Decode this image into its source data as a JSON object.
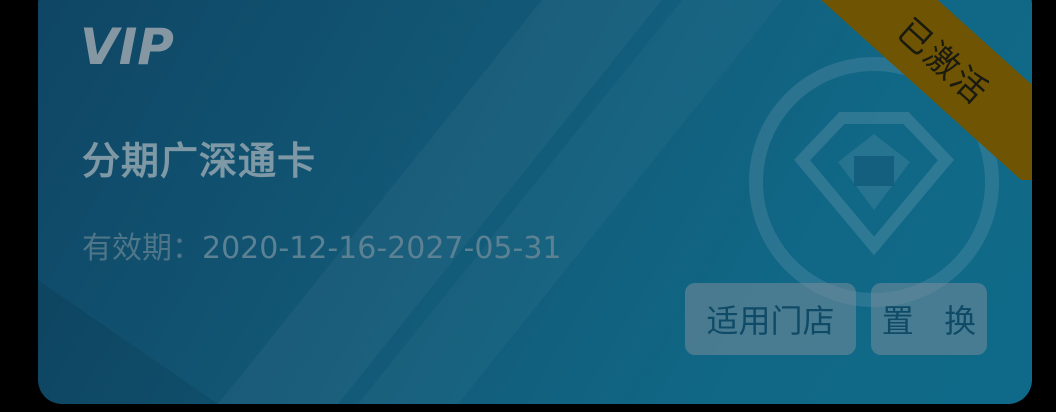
{
  "card": {
    "brand": "VIP",
    "title": "分期广深通卡",
    "validity_label": "有效期：",
    "validity_range": "2020-12-16-2027-05-31",
    "status_badge": "已激活"
  },
  "actions": {
    "stores_label": "适用门店",
    "replace_label": "置 换"
  },
  "colors": {
    "card_start": "#0f4564",
    "card_end": "#0e6a88",
    "badge": "#6e5403",
    "button_bg": "#7a8d9b"
  },
  "icons": {
    "watermark": "diamond-emblem-icon",
    "logo": "vip-logo"
  }
}
